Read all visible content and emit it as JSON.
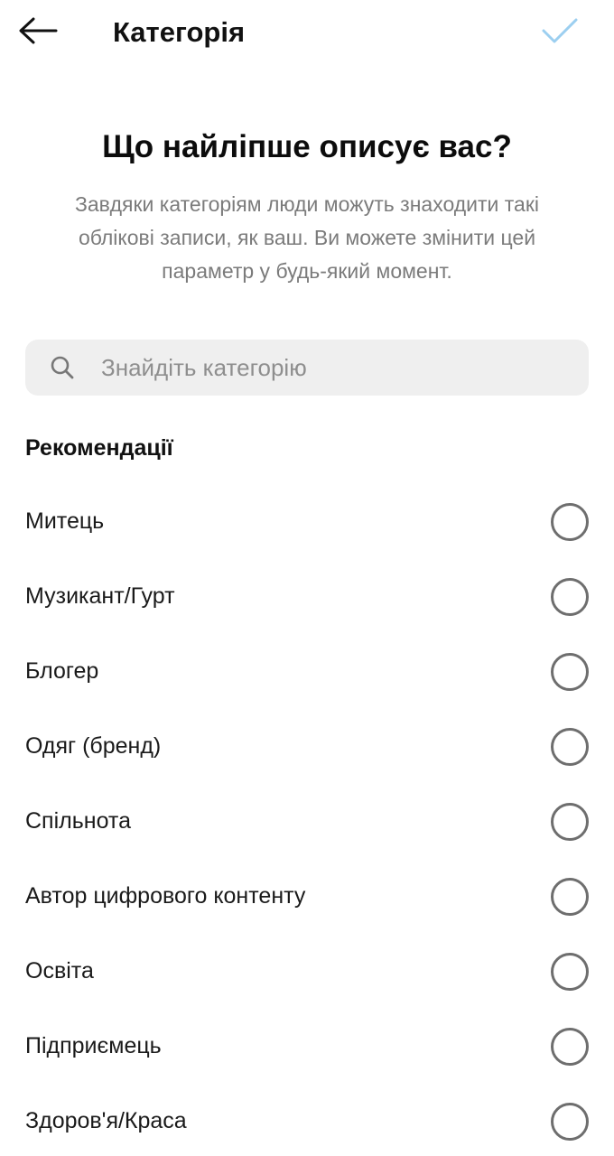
{
  "header": {
    "title": "Категорія",
    "back_icon": "arrow-left-icon",
    "confirm_icon": "checkmark-icon",
    "confirm_color": "#9ccff0"
  },
  "intro": {
    "headline": "Що найліпше описує вас?",
    "description": "Завдяки категоріям люди можуть знаходити такі облікові записи, як ваш. Ви можете змінити цей параметр у будь-який момент."
  },
  "search": {
    "placeholder": "Знайдіть категорію",
    "value": "",
    "icon": "search-icon"
  },
  "recommendations": {
    "title": "Рекомендації",
    "items": [
      {
        "label": "Митець",
        "selected": false
      },
      {
        "label": "Музикант/Гурт",
        "selected": false
      },
      {
        "label": "Блогер",
        "selected": false
      },
      {
        "label": "Одяг (бренд)",
        "selected": false
      },
      {
        "label": "Спільнота",
        "selected": false
      },
      {
        "label": "Автор цифрового контенту",
        "selected": false
      },
      {
        "label": "Освіта",
        "selected": false
      },
      {
        "label": "Підприємець",
        "selected": false
      },
      {
        "label": "Здоров'я/Краса",
        "selected": false
      }
    ]
  }
}
